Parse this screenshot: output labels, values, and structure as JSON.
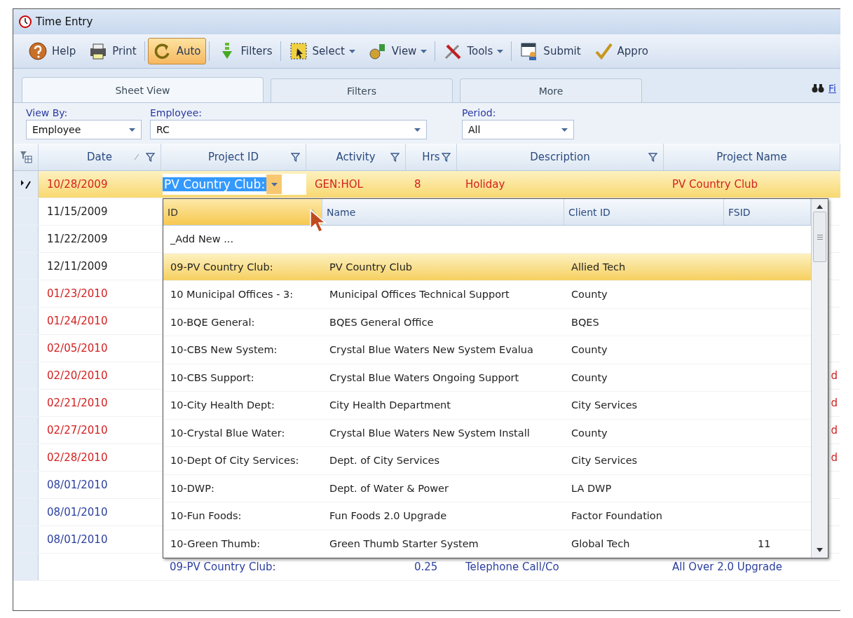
{
  "window": {
    "title": "Time Entry"
  },
  "toolbar": [
    {
      "label": "Help",
      "kind": "help",
      "pressed": false,
      "dropdown": false
    },
    {
      "label": "Print",
      "kind": "print",
      "pressed": false,
      "dropdown": false
    },
    {
      "label": "Auto",
      "kind": "auto",
      "pressed": true,
      "dropdown": false
    },
    {
      "label": "Filters",
      "kind": "filters",
      "pressed": false,
      "dropdown": false
    },
    {
      "label": "Select",
      "kind": "select",
      "pressed": false,
      "dropdown": true
    },
    {
      "label": "View",
      "kind": "view",
      "pressed": false,
      "dropdown": true
    },
    {
      "label": "Tools",
      "kind": "tools",
      "pressed": false,
      "dropdown": true
    },
    {
      "label": "Submit",
      "kind": "submit",
      "pressed": false,
      "dropdown": false
    },
    {
      "label": "Appro",
      "kind": "approve",
      "pressed": false,
      "dropdown": false
    }
  ],
  "tabs": [
    {
      "label": "Sheet View",
      "selected": true
    },
    {
      "label": "Filters",
      "selected": false
    },
    {
      "label": "More",
      "selected": false
    }
  ],
  "find_link": "Fi",
  "filters": [
    {
      "label": "View By:",
      "value": "Employee"
    },
    {
      "label": "Employee:",
      "value": "RC"
    },
    {
      "label": "Period:",
      "value": "All"
    }
  ],
  "grid": {
    "columns": [
      {
        "label": "Date",
        "filter": true,
        "sorted": true
      },
      {
        "label": "Project ID",
        "filter": true,
        "sorted": false
      },
      {
        "label": "Activity",
        "filter": true,
        "sorted": false
      },
      {
        "label": "Hrs",
        "filter": true,
        "sorted": false
      },
      {
        "label": "Description",
        "filter": true,
        "sorted": false
      },
      {
        "label": "Project Name",
        "filter": false,
        "sorted": false
      }
    ],
    "rows": [
      {
        "selected": true,
        "editing": true,
        "color": "#d42020",
        "date": "10/28/2009",
        "project_id": "PV Country Club:",
        "activity": "GEN:HOL",
        "hrs": "8",
        "description": "Holiday",
        "project_name": "PV Country Club"
      },
      {
        "selected": false,
        "editing": false,
        "color": "#222222",
        "date": "11/15/2009"
      },
      {
        "selected": false,
        "editing": false,
        "color": "#222222",
        "date": "11/22/2009"
      },
      {
        "selected": false,
        "editing": false,
        "color": "#222222",
        "date": "12/11/2009"
      },
      {
        "selected": false,
        "editing": false,
        "color": "#d42020",
        "date": "01/23/2010"
      },
      {
        "selected": false,
        "editing": false,
        "color": "#d42020",
        "date": "01/24/2010"
      },
      {
        "selected": false,
        "editing": false,
        "color": "#d42020",
        "date": "02/05/2010"
      },
      {
        "selected": false,
        "editing": false,
        "color": "#d42020",
        "date": "02/20/2010",
        "project_name": "d"
      },
      {
        "selected": false,
        "editing": false,
        "color": "#d42020",
        "date": "02/21/2010",
        "project_name": "d"
      },
      {
        "selected": false,
        "editing": false,
        "color": "#d42020",
        "date": "02/27/2010",
        "project_name": "d"
      },
      {
        "selected": false,
        "editing": false,
        "color": "#d42020",
        "date": "02/28/2010",
        "project_name": "d"
      },
      {
        "selected": false,
        "editing": false,
        "color": "#2b3f9e",
        "date": "08/01/2010"
      },
      {
        "selected": false,
        "editing": false,
        "color": "#2b3f9e",
        "date": "08/01/2010"
      },
      {
        "selected": false,
        "editing": false,
        "color": "#2b3f9e",
        "date": "08/01/2010"
      },
      {
        "selected": false,
        "editing": false,
        "color": "#2b3f9e",
        "project_id": "09-PV Country Club:",
        "hrs": "0.25",
        "description": "Telephone Call/Co",
        "project_name": "All Over 2.0 Upgrade"
      }
    ]
  },
  "dropdown": {
    "columns": [
      "ID",
      "Name",
      "Client ID",
      "FSID"
    ],
    "rows": [
      {
        "selected": false,
        "id": "_Add New ..."
      },
      {
        "selected": true,
        "id": "09-PV Country Club:",
        "name": "PV Country Club",
        "client_id": "Allied Tech"
      },
      {
        "selected": false,
        "id": "10 Municipal Offices - 3:",
        "name": "Municipal Offices Technical Support",
        "client_id": "County"
      },
      {
        "selected": false,
        "id": "10-BQE General:",
        "name": "BQES General Office",
        "client_id": "BQES"
      },
      {
        "selected": false,
        "id": "10-CBS New System:",
        "name": "Crystal Blue Waters New System Evalua",
        "client_id": "County"
      },
      {
        "selected": false,
        "id": "10-CBS Support:",
        "name": "Crystal Blue Waters Ongoing Support",
        "client_id": "County"
      },
      {
        "selected": false,
        "id": "10-City Health Dept:",
        "name": "City Health Department",
        "client_id": "City Services"
      },
      {
        "selected": false,
        "id": "10-Crystal Blue Water:",
        "name": "Crystal Blue Waters New System Install",
        "client_id": "County"
      },
      {
        "selected": false,
        "id": "10-Dept Of City Services:",
        "name": "Dept. of City Services",
        "client_id": "City Services"
      },
      {
        "selected": false,
        "id": "10-DWP:",
        "name": "Dept. of Water & Power",
        "client_id": "LA DWP"
      },
      {
        "selected": false,
        "id": "10-Fun Foods:",
        "name": "Fun Foods 2.0 Upgrade",
        "client_id": "Factor Foundation"
      },
      {
        "selected": false,
        "id": "10-Green Thumb:",
        "name": "Green Thumb Starter System",
        "client_id": "Global Tech",
        "fsid": "11"
      }
    ]
  }
}
